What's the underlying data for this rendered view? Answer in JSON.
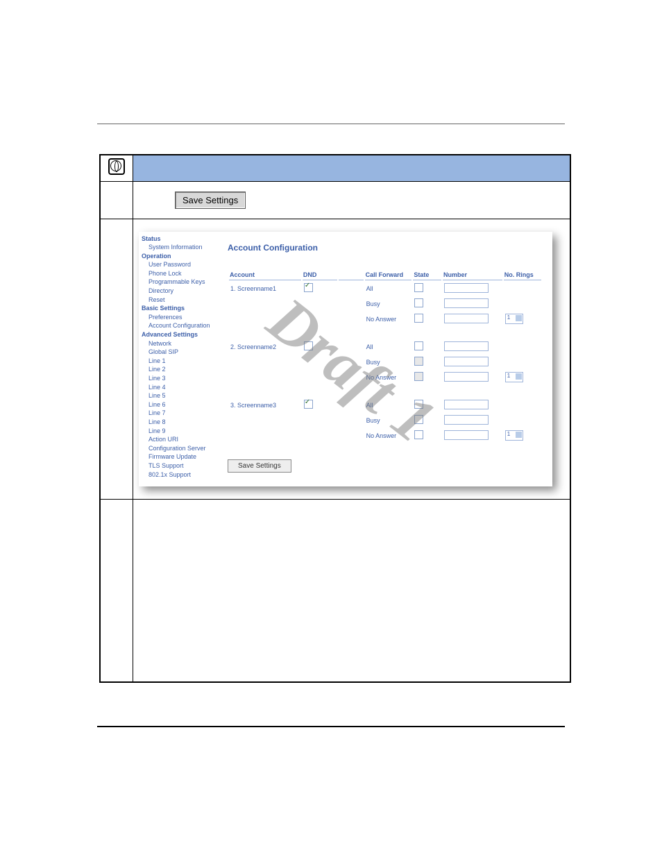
{
  "buttons": {
    "save_outer": "Save Settings",
    "save_inner": "Save Settings"
  },
  "sidebar": {
    "groups": [
      {
        "header": "Status",
        "items": [
          "System Information"
        ]
      },
      {
        "header": "Operation",
        "items": [
          "User Password",
          "Phone Lock",
          "Programmable Keys",
          "Directory",
          "Reset"
        ]
      },
      {
        "header": "Basic Settings",
        "items": [
          "Preferences",
          "Account Configuration"
        ]
      },
      {
        "header": "Advanced Settings",
        "items": [
          "Network",
          "Global SIP",
          "Line 1",
          "Line 2",
          "Line 3",
          "Line 4",
          "Line 5",
          "Line 6",
          "Line 7",
          "Line 8",
          "Line 9",
          "Action URI",
          "Configuration Server",
          "Firmware Update",
          "TLS Support",
          "802.1x Support"
        ]
      }
    ]
  },
  "content": {
    "title": "Account Configuration",
    "columns": {
      "account": "Account",
      "dnd": "DND",
      "call_forward": "Call Forward",
      "state": "State",
      "number": "Number",
      "no_rings": "No. Rings"
    },
    "accounts": [
      {
        "label": "1. Screenname1",
        "dnd_checked": true,
        "rows": [
          {
            "cf": "All"
          },
          {
            "cf": "Busy"
          },
          {
            "cf": "No Answer",
            "rings": "1"
          }
        ]
      },
      {
        "label": "2. Screenname2",
        "dnd_checked": false,
        "rows": [
          {
            "cf": "All"
          },
          {
            "cf": "Busy"
          },
          {
            "cf": "No Answer",
            "rings": "1"
          }
        ]
      },
      {
        "label": "3. Screenname3",
        "dnd_checked": true,
        "rows": [
          {
            "cf": "All"
          },
          {
            "cf": "Busy"
          },
          {
            "cf": "No Answer",
            "rings": "1"
          }
        ]
      }
    ]
  },
  "watermark": "Draft 1"
}
